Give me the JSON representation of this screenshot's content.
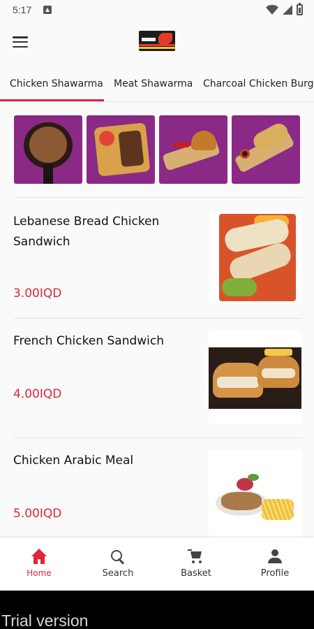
{
  "status_bar": {
    "time": "5:17"
  },
  "categories": [
    {
      "label": "Chicken Shawarma",
      "selected": true
    },
    {
      "label": "Meat Shawarma",
      "selected": false
    },
    {
      "label": "Charcoal Chicken Burge",
      "selected": false
    }
  ],
  "products": [
    {
      "name": "Lebanese Bread Chicken Sandwich",
      "price": "3.00IQD"
    },
    {
      "name": "French Chicken Sandwich",
      "price": "4.00IQD"
    },
    {
      "name": "Chicken Arabic Meal",
      "price": "5.00IQD"
    }
  ],
  "bottom_nav": [
    {
      "label": "Home",
      "icon": "home-icon",
      "active": true
    },
    {
      "label": "Search",
      "icon": "search-icon",
      "active": false
    },
    {
      "label": "Basket",
      "icon": "cart-icon",
      "active": false
    },
    {
      "label": "Profile",
      "icon": "profile-icon",
      "active": false
    }
  ],
  "trial_banner": "Trial version",
  "colors": {
    "accent": "#e0243a",
    "banner_background": "#8a2a86",
    "background": "#fafafa"
  }
}
